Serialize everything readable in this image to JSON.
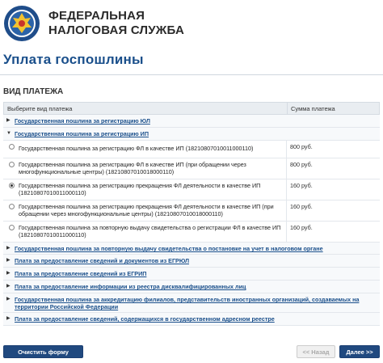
{
  "brand": {
    "line1": "ФЕДЕРАЛЬНАЯ",
    "line2": "НАЛОГОВАЯ СЛУЖБА"
  },
  "page": {
    "title": "Уплата госпошлины",
    "section": "ВИД ПЛАТЕЖА"
  },
  "table": {
    "col_type": "Выберите вид платежа",
    "col_amount": "Сумма платежа",
    "cat_yul": "Государственная пошлина за регистрацию ЮЛ",
    "cat_ip": "Государственная пошлина за регистрацию ИП",
    "options": [
      {
        "label": "Государственная пошлина за регистрацию ФЛ в качестве ИП (18210807010011000110)",
        "amount": "800 руб."
      },
      {
        "label": "Государственная пошлина за регистрацию ФЛ в качестве ИП (при обращении через многофункциональные центры) (18210807010018000110)",
        "amount": "800 руб."
      },
      {
        "label": "Государственная пошлина за регистрацию прекращения ФЛ деятельности в качестве ИП (18210807010011000110)",
        "amount": "160 руб."
      },
      {
        "label": "Государственная пошлина за регистрацию прекращения ФЛ деятельности в качестве ИП (при обращении через многофункциональные центры) (18210807010018000110)",
        "amount": "160 руб."
      },
      {
        "label": "Государственная пошлина за повторную выдачу свидетельства о регистрации ФЛ в качестве ИП (18210807010011000110)",
        "amount": "160 руб."
      }
    ],
    "categories": [
      "Государственная пошлина за повторную выдачу свидетельства о постановке на учет в налоговом органе",
      "Плата за предоставление сведений и документов из ЕГРЮЛ",
      "Плата за предоставление сведений из ЕГРИП",
      "Плата за предоставление информации из реестра дисквалифицированных лиц",
      "Государственная пошлина за аккредитацию филиалов, представительств иностранных организаций, создаваемых на территории Российской Федерации",
      "Плата за предоставление сведений, содержащихся в государственном адресном реестре"
    ]
  },
  "buttons": {
    "clear": "Очистить форму",
    "back": "<< Назад",
    "next": "Далее >>"
  },
  "colors": {
    "accent": "#1a4f8b",
    "button": "#20497f"
  },
  "icons": {
    "logo": "fns-emblem-icon",
    "expanded": "triangle-down-icon",
    "collapsed": "triangle-right-icon"
  }
}
